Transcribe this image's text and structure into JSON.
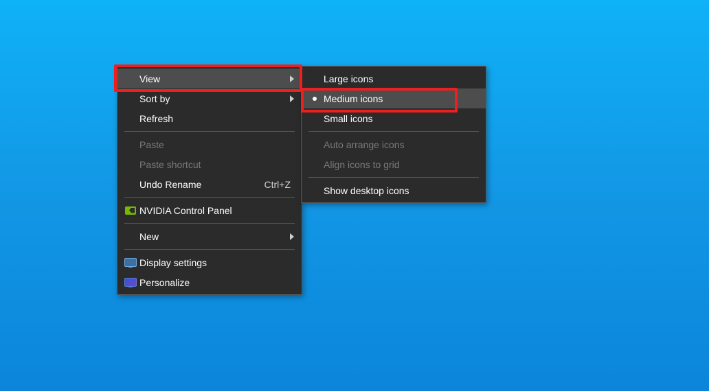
{
  "primary_menu": {
    "view": {
      "label": "View"
    },
    "sort_by": {
      "label": "Sort by"
    },
    "refresh": {
      "label": "Refresh"
    },
    "paste": {
      "label": "Paste"
    },
    "paste_shortcut": {
      "label": "Paste shortcut"
    },
    "undo_rename": {
      "label": "Undo Rename",
      "shortcut": "Ctrl+Z"
    },
    "nvidia": {
      "label": "NVIDIA Control Panel"
    },
    "new": {
      "label": "New"
    },
    "display": {
      "label": "Display settings"
    },
    "personalize": {
      "label": "Personalize"
    }
  },
  "view_submenu": {
    "large": {
      "label": "Large icons"
    },
    "medium": {
      "label": "Medium icons",
      "selected": true
    },
    "small": {
      "label": "Small icons"
    },
    "auto": {
      "label": "Auto arrange icons"
    },
    "align": {
      "label": "Align icons to grid"
    },
    "show": {
      "label": "Show desktop icons"
    }
  },
  "annotations": {
    "highlight_view": true,
    "highlight_medium": true
  }
}
